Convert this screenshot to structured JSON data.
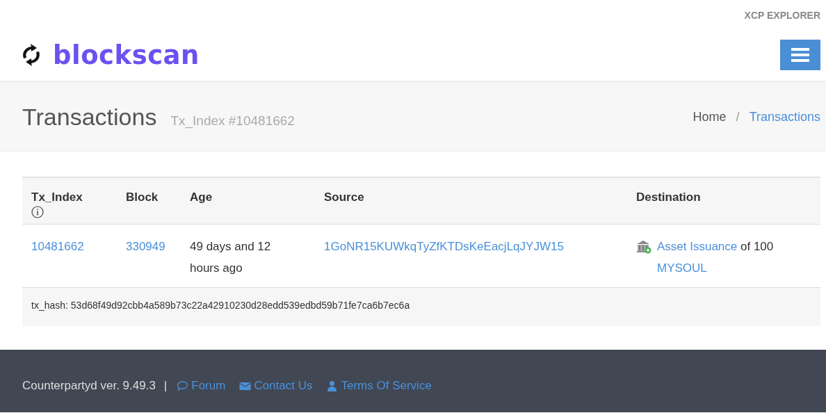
{
  "top_bar": {
    "title": "XCP EXPLORER"
  },
  "header": {
    "logo_text": "blockscan"
  },
  "page_head": {
    "title": "Transactions",
    "subtitle": "Tx_Index #10481662",
    "breadcrumb": [
      {
        "label": "Home",
        "kind": "text"
      },
      {
        "label": "Transactions",
        "kind": "link"
      }
    ],
    "separator": "/"
  },
  "table": {
    "columns": [
      {
        "label": "Tx_Index",
        "kind": "with_info"
      },
      {
        "label": "Block",
        "kind": "plain"
      },
      {
        "label": "Age",
        "kind": "plain"
      },
      {
        "label": "Source",
        "kind": "plain"
      },
      {
        "label": "Destination",
        "kind": "plain"
      }
    ],
    "rows": [
      {
        "tx_index": "10481662",
        "block": "330949",
        "age": "49 days and 12 hours ago",
        "source": "1GoNR15KUWkqTyZfKTDsKeEacjLqJYJW15",
        "destination": [
          {
            "kind": "link",
            "text": "Asset Issuance"
          },
          {
            "kind": "text",
            "text": " of 100 "
          },
          {
            "kind": "link",
            "text": "MYSOUL"
          }
        ],
        "tx_hash": "tx_hash: 53d68f49d92cbb4a589b73c22a42910230d28edd539edbd59b71fe7ca6b7ec6a"
      }
    ]
  },
  "footer": {
    "version": "Counterpartyd ver. 9.49.3",
    "divider": "|",
    "links": [
      {
        "kind": "forum",
        "label": "Forum"
      },
      {
        "kind": "contact",
        "label": "Contact Us"
      },
      {
        "kind": "terms",
        "label": "Terms Of Service"
      }
    ]
  }
}
